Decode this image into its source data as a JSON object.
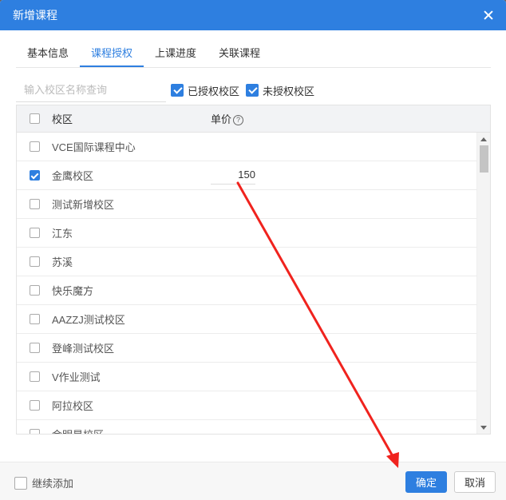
{
  "dialog": {
    "title": "新增课程",
    "close_icon": "close-icon"
  },
  "tabs": [
    {
      "label": "基本信息",
      "active": false
    },
    {
      "label": "课程授权",
      "active": true
    },
    {
      "label": "上课进度",
      "active": false
    },
    {
      "label": "关联课程",
      "active": false
    }
  ],
  "filters": {
    "search_placeholder": "输入校区名称查询",
    "search_value": "",
    "authorized": {
      "label": "已授权校区",
      "checked": true
    },
    "unauthorized": {
      "label": "未授权校区",
      "checked": true
    }
  },
  "table": {
    "headers": {
      "campus": "校区",
      "price": "单价",
      "help_icon": "question-circle-icon"
    },
    "rows": [
      {
        "name": "VCE国际课程中心",
        "checked": false,
        "price": ""
      },
      {
        "name": "金鹰校区",
        "checked": true,
        "price": "150"
      },
      {
        "name": "测试新增校区",
        "checked": false,
        "price": ""
      },
      {
        "name": "江东",
        "checked": false,
        "price": ""
      },
      {
        "name": "苏溪",
        "checked": false,
        "price": ""
      },
      {
        "name": "快乐魔方",
        "checked": false,
        "price": ""
      },
      {
        "name": "AAZZJ测试校区",
        "checked": false,
        "price": ""
      },
      {
        "name": "登峰测试校区",
        "checked": false,
        "price": ""
      },
      {
        "name": "V作业测试",
        "checked": false,
        "price": ""
      },
      {
        "name": "阿拉校区",
        "checked": false,
        "price": ""
      },
      {
        "name": "金明星校区",
        "checked": false,
        "price": ""
      }
    ]
  },
  "footer": {
    "continue_label": "继续添加",
    "continue_checked": false,
    "ok_label": "确定",
    "cancel_label": "取消"
  },
  "annotation": {
    "color": "#f0231e"
  },
  "colors": {
    "primary": "#2e7fe0"
  }
}
